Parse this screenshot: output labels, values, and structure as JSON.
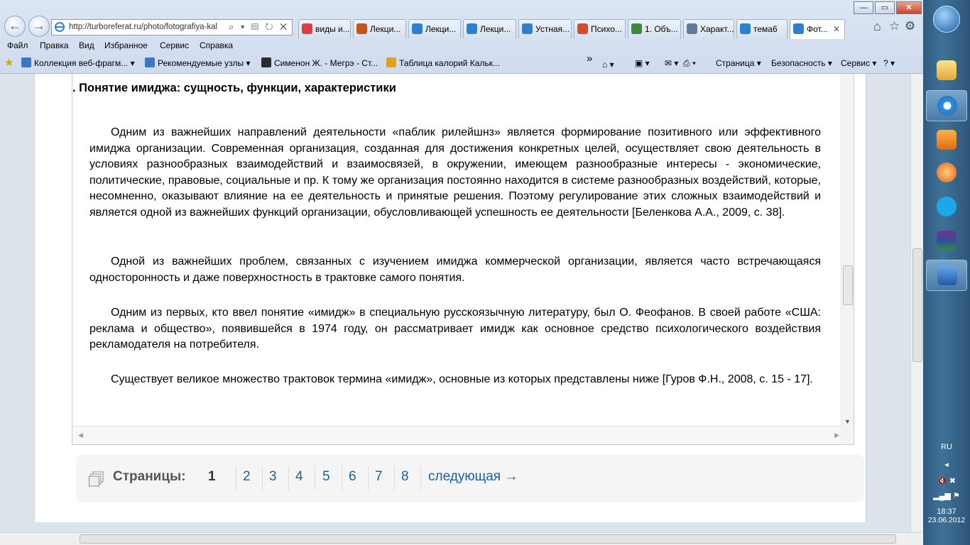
{
  "browser": {
    "url": "http://turboreferat.ru/photo/fotografiya-kal",
    "tabs": [
      {
        "label": "виды и...",
        "color": "#e23b3b"
      },
      {
        "label": "Лекци...",
        "color": "#c2541c"
      },
      {
        "label": "Лекци...",
        "color": "#2d7fd2"
      },
      {
        "label": "Лекци...",
        "color": "#2d7fd2"
      },
      {
        "label": "Устная...",
        "color": "#2d7fd2"
      },
      {
        "label": "Психо...",
        "color": "#d9492d"
      },
      {
        "label": "1. Объ...",
        "color": "#3a8a3a"
      },
      {
        "label": "Характ...",
        "color": "#5d7b9e"
      },
      {
        "label": "тема6",
        "color": "#2d7fd2"
      },
      {
        "label": "Фот...",
        "color": "#2d7fd2"
      }
    ],
    "menu": [
      "Файл",
      "Правка",
      "Вид",
      "Избранное",
      "Сервис",
      "Справка"
    ],
    "favorites": [
      {
        "label": "Коллекция веб-фрагм...",
        "color": "#3b78c4"
      },
      {
        "label": "Рекомендуемые узлы",
        "color": "#3b78c4"
      },
      {
        "label": "Сименон Ж. - Мегрэ - Ст...",
        "color": "#2b2b2b"
      },
      {
        "label": "Таблица калорий  Кальк...",
        "color": "#e0a020"
      }
    ],
    "commands": [
      "Страница",
      "Безопасность",
      "Сервис"
    ],
    "overflow": "»"
  },
  "document": {
    "heading_prefix": ".",
    "heading": ". Понятие имиджа: сущность, функции, характеристики",
    "paragraphs": [
      "Одним из важнейших направлений деятельности «паблик рилейшнз» является формирование позитивного или эффективного имиджа организации. Современная организация, созданная для достижения конкретных целей, осуществляет свою деятельность в условиях разнообразных взаимодействий и взаимосвязей, в окружении, имеющем разнообразные интересы - экономические, политические, правовые, социальные и пр. К тому же организация постоянно находится в системе разнообразных воздействий, которые, несомненно, оказывают влияние на ее деятельность и принятые решения. Поэтому регулирование этих сложных взаимодействий и является одной из важнейших функций организации, обусловливающей успешность ее деятельности [Беленкова А.А., 2009, с. 38].",
      "Одной из важнейших проблем, связанных с изучением имиджа коммерческой организации, является часто встречающаяся односторонность и даже поверхностность в трактовке самого понятия.",
      "Одним из первых, кто ввел понятие «имидж» в специальную русскоязычную литературу, был О. Феофанов. В своей работе «США: реклама и общество», появившейся в 1974 году, он рассматривает имидж как основное средство психологического воздействия рекламодателя на потребителя.",
      "Существует великое множество трактовок термина «имидж», основные из которых представлены ниже [Гуров Ф.Н., 2008, с. 15 - 17]."
    ]
  },
  "pagination": {
    "label": "Страницы:",
    "current": "1",
    "pages": [
      "2",
      "3",
      "4",
      "5",
      "6",
      "7",
      "8"
    ],
    "next": "следующая →"
  },
  "system": {
    "lang": "RU",
    "time": "18:37",
    "date": "23.06.2012"
  },
  "colors": {
    "link": "#1a5fa6",
    "taskbar": "#3f7299"
  }
}
